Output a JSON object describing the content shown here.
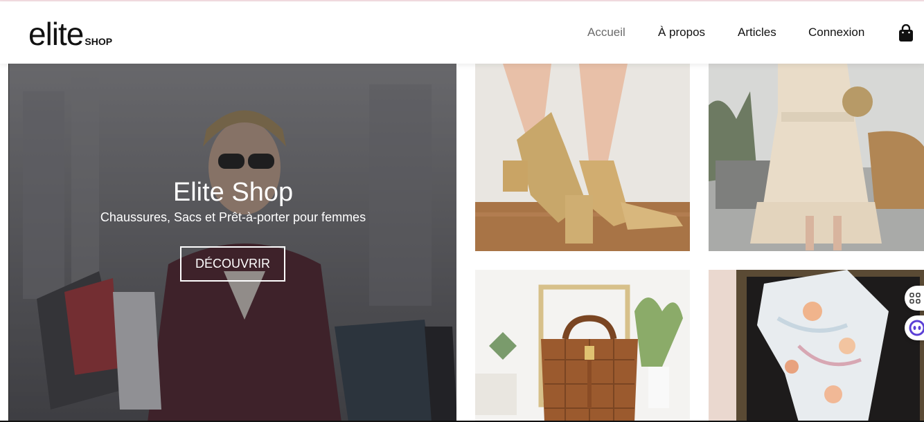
{
  "brand": {
    "name": "elite",
    "sub": "SHOP"
  },
  "nav": {
    "items": [
      {
        "label": "Accueil",
        "active": true
      },
      {
        "label": "À propos",
        "active": false
      },
      {
        "label": "Articles",
        "active": false
      },
      {
        "label": "Connexion",
        "active": false
      }
    ],
    "cart_icon": "shopping-bag-icon"
  },
  "hero": {
    "title": "Elite Shop",
    "subtitle": "Chaussures, Sacs et Prêt-à-porter pour femmes",
    "cta": "DÉCOUVRIR"
  },
  "tiles": [
    {
      "name": "gold-sandals-image"
    },
    {
      "name": "beige-dress-image"
    },
    {
      "name": "brown-handbag-image"
    },
    {
      "name": "silk-scarf-image"
    }
  ],
  "widgets": [
    {
      "icon": "apps-grid-icon"
    },
    {
      "icon": "chat-bot-icon"
    }
  ],
  "colors": {
    "accent": "#111111",
    "nav_active": "#6b6b6b",
    "widget_purple": "#5b3fd6"
  }
}
